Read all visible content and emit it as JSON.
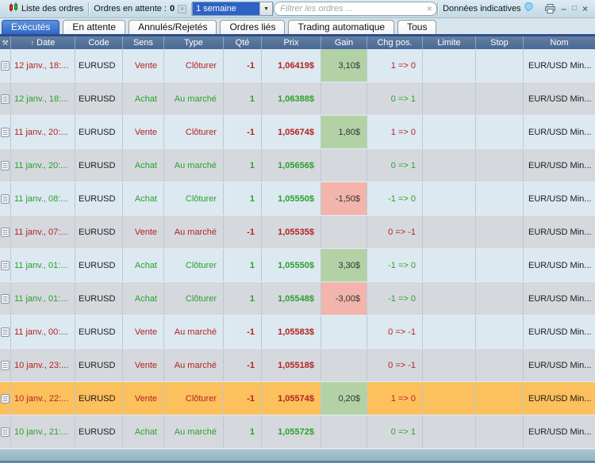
{
  "toolbar": {
    "title": "Liste des ordres",
    "pending_label": "Ordres en attente :",
    "pending_count": "0",
    "period": "1 semaine",
    "chevron": "▼",
    "filter_placeholder": "Filtrer les ordres ...",
    "clear_glyph": "✕",
    "indicative": "Données indicatives",
    "minimize_glyph": "–",
    "maximize_glyph": "□",
    "close_glyph": "×"
  },
  "tabs": [
    {
      "label": "Exécutés",
      "active": true
    },
    {
      "label": "En attente",
      "active": false
    },
    {
      "label": "Annulés/Rejetés",
      "active": false
    },
    {
      "label": "Ordres liés",
      "active": false
    },
    {
      "label": "Trading automatique",
      "active": false
    },
    {
      "label": "Tous",
      "active": false
    }
  ],
  "table": {
    "sort_icon": "↑",
    "wrench_icon": "⚒",
    "columns": [
      "Date",
      "Code",
      "Sens",
      "Type",
      "Qté",
      "Prix",
      "Gain",
      "Chg pos.",
      "Limite",
      "Stop",
      "Nom"
    ],
    "rows": [
      {
        "date": "12 janv., 18:...",
        "code": "EURUSD",
        "sens": "Vente",
        "type": "Clôturer",
        "qty": "-1",
        "price": "1,06419$",
        "gain": "3,10$",
        "gain_sign": "pos",
        "chg": "1 => 0",
        "chg_dir": "neg",
        "limit": "",
        "stop": "",
        "name": "EUR/USD Min...",
        "side": "sell",
        "selected": false
      },
      {
        "date": "12 janv., 18:...",
        "code": "EURUSD",
        "sens": "Achat",
        "type": "Au marché",
        "qty": "1",
        "price": "1,06388$",
        "gain": "",
        "gain_sign": "none",
        "chg": "0 => 1",
        "chg_dir": "pos",
        "limit": "",
        "stop": "",
        "name": "EUR/USD Min...",
        "side": "buy",
        "selected": false
      },
      {
        "date": "11 janv., 20:...",
        "code": "EURUSD",
        "sens": "Vente",
        "type": "Clôturer",
        "qty": "-1",
        "price": "1,05674$",
        "gain": "1,80$",
        "gain_sign": "pos",
        "chg": "1 => 0",
        "chg_dir": "neg",
        "limit": "",
        "stop": "",
        "name": "EUR/USD Min...",
        "side": "sell",
        "selected": false
      },
      {
        "date": "11 janv., 20:...",
        "code": "EURUSD",
        "sens": "Achat",
        "type": "Au marché",
        "qty": "1",
        "price": "1,05656$",
        "gain": "",
        "gain_sign": "none",
        "chg": "0 => 1",
        "chg_dir": "pos",
        "limit": "",
        "stop": "",
        "name": "EUR/USD Min...",
        "side": "buy",
        "selected": false
      },
      {
        "date": "11 janv., 08:...",
        "code": "EURUSD",
        "sens": "Achat",
        "type": "Clôturer",
        "qty": "1",
        "price": "1,05550$",
        "gain": "-1,50$",
        "gain_sign": "neg",
        "chg": "-1 => 0",
        "chg_dir": "pos",
        "limit": "",
        "stop": "",
        "name": "EUR/USD Min...",
        "side": "buy",
        "selected": false
      },
      {
        "date": "11 janv., 07:...",
        "code": "EURUSD",
        "sens": "Vente",
        "type": "Au marché",
        "qty": "-1",
        "price": "1,05535$",
        "gain": "",
        "gain_sign": "none",
        "chg": "0 => -1",
        "chg_dir": "neg",
        "limit": "",
        "stop": "",
        "name": "EUR/USD Min...",
        "side": "sell",
        "selected": false
      },
      {
        "date": "11 janv., 01:...",
        "code": "EURUSD",
        "sens": "Achat",
        "type": "Clôturer",
        "qty": "1",
        "price": "1,05550$",
        "gain": "3,30$",
        "gain_sign": "pos",
        "chg": "-1 => 0",
        "chg_dir": "pos",
        "limit": "",
        "stop": "",
        "name": "EUR/USD Min...",
        "side": "buy",
        "selected": false
      },
      {
        "date": "11 janv., 01:...",
        "code": "EURUSD",
        "sens": "Achat",
        "type": "Clôturer",
        "qty": "1",
        "price": "1,05548$",
        "gain": "-3,00$",
        "gain_sign": "neg",
        "chg": "-1 => 0",
        "chg_dir": "pos",
        "limit": "",
        "stop": "",
        "name": "EUR/USD Min...",
        "side": "buy",
        "selected": false
      },
      {
        "date": "11 janv., 00:...",
        "code": "EURUSD",
        "sens": "Vente",
        "type": "Au marché",
        "qty": "-1",
        "price": "1,05583$",
        "gain": "",
        "gain_sign": "none",
        "chg": "0 => -1",
        "chg_dir": "neg",
        "limit": "",
        "stop": "",
        "name": "EUR/USD Min...",
        "side": "sell",
        "selected": false
      },
      {
        "date": "10 janv., 23:...",
        "code": "EURUSD",
        "sens": "Vente",
        "type": "Au marché",
        "qty": "-1",
        "price": "1,05518$",
        "gain": "",
        "gain_sign": "none",
        "chg": "0 => -1",
        "chg_dir": "neg",
        "limit": "",
        "stop": "",
        "name": "EUR/USD Min...",
        "side": "sell",
        "selected": false
      },
      {
        "date": "10 janv., 22:...",
        "code": "EURUSD",
        "sens": "Vente",
        "type": "Clôturer",
        "qty": "-1",
        "price": "1,05574$",
        "gain": "0,20$",
        "gain_sign": "pos",
        "chg": "1 => 0",
        "chg_dir": "neg",
        "limit": "",
        "stop": "",
        "name": "EUR/USD Min...",
        "side": "sell",
        "selected": true
      },
      {
        "date": "10 janv., 21:...",
        "code": "EURUSD",
        "sens": "Achat",
        "type": "Au marché",
        "qty": "1",
        "price": "1,05572$",
        "gain": "",
        "gain_sign": "none",
        "chg": "0 => 1",
        "chg_dir": "pos",
        "limit": "",
        "stop": "",
        "name": "EUR/USD Min...",
        "side": "buy",
        "selected": false
      }
    ]
  },
  "colors": {
    "buy_green": "#2da02d",
    "sell_red": "#b42222",
    "gain_positive_bg": "#b2d2a5",
    "gain_negative_bg": "#f3b4ab",
    "selected_row_bg": "#fcc05c",
    "header_bg": "#4f6f9c",
    "active_tab_bg": "#3d74cf",
    "period_selected_bg": "#2e62c4"
  }
}
